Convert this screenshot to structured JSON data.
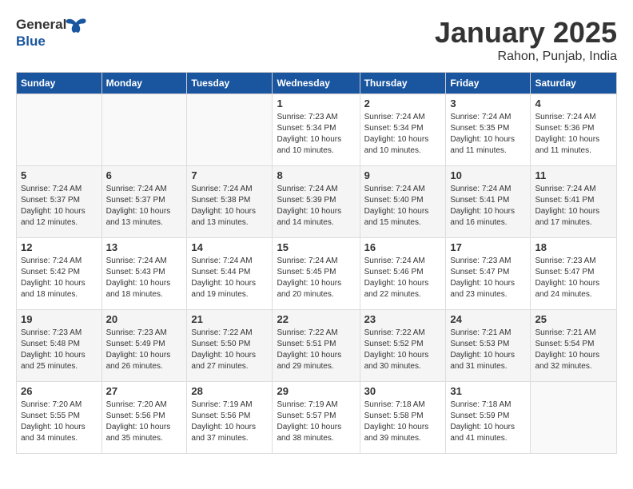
{
  "header": {
    "logo_general": "General",
    "logo_blue": "Blue",
    "month_title": "January 2025",
    "location": "Rahon, Punjab, India"
  },
  "days_of_week": [
    "Sunday",
    "Monday",
    "Tuesday",
    "Wednesday",
    "Thursday",
    "Friday",
    "Saturday"
  ],
  "weeks": [
    [
      {
        "day": "",
        "info": ""
      },
      {
        "day": "",
        "info": ""
      },
      {
        "day": "",
        "info": ""
      },
      {
        "day": "1",
        "info": "Sunrise: 7:23 AM\nSunset: 5:34 PM\nDaylight: 10 hours\nand 10 minutes."
      },
      {
        "day": "2",
        "info": "Sunrise: 7:24 AM\nSunset: 5:34 PM\nDaylight: 10 hours\nand 10 minutes."
      },
      {
        "day": "3",
        "info": "Sunrise: 7:24 AM\nSunset: 5:35 PM\nDaylight: 10 hours\nand 11 minutes."
      },
      {
        "day": "4",
        "info": "Sunrise: 7:24 AM\nSunset: 5:36 PM\nDaylight: 10 hours\nand 11 minutes."
      }
    ],
    [
      {
        "day": "5",
        "info": "Sunrise: 7:24 AM\nSunset: 5:37 PM\nDaylight: 10 hours\nand 12 minutes."
      },
      {
        "day": "6",
        "info": "Sunrise: 7:24 AM\nSunset: 5:37 PM\nDaylight: 10 hours\nand 13 minutes."
      },
      {
        "day": "7",
        "info": "Sunrise: 7:24 AM\nSunset: 5:38 PM\nDaylight: 10 hours\nand 13 minutes."
      },
      {
        "day": "8",
        "info": "Sunrise: 7:24 AM\nSunset: 5:39 PM\nDaylight: 10 hours\nand 14 minutes."
      },
      {
        "day": "9",
        "info": "Sunrise: 7:24 AM\nSunset: 5:40 PM\nDaylight: 10 hours\nand 15 minutes."
      },
      {
        "day": "10",
        "info": "Sunrise: 7:24 AM\nSunset: 5:41 PM\nDaylight: 10 hours\nand 16 minutes."
      },
      {
        "day": "11",
        "info": "Sunrise: 7:24 AM\nSunset: 5:41 PM\nDaylight: 10 hours\nand 17 minutes."
      }
    ],
    [
      {
        "day": "12",
        "info": "Sunrise: 7:24 AM\nSunset: 5:42 PM\nDaylight: 10 hours\nand 18 minutes."
      },
      {
        "day": "13",
        "info": "Sunrise: 7:24 AM\nSunset: 5:43 PM\nDaylight: 10 hours\nand 18 minutes."
      },
      {
        "day": "14",
        "info": "Sunrise: 7:24 AM\nSunset: 5:44 PM\nDaylight: 10 hours\nand 19 minutes."
      },
      {
        "day": "15",
        "info": "Sunrise: 7:24 AM\nSunset: 5:45 PM\nDaylight: 10 hours\nand 20 minutes."
      },
      {
        "day": "16",
        "info": "Sunrise: 7:24 AM\nSunset: 5:46 PM\nDaylight: 10 hours\nand 22 minutes."
      },
      {
        "day": "17",
        "info": "Sunrise: 7:23 AM\nSunset: 5:47 PM\nDaylight: 10 hours\nand 23 minutes."
      },
      {
        "day": "18",
        "info": "Sunrise: 7:23 AM\nSunset: 5:47 PM\nDaylight: 10 hours\nand 24 minutes."
      }
    ],
    [
      {
        "day": "19",
        "info": "Sunrise: 7:23 AM\nSunset: 5:48 PM\nDaylight: 10 hours\nand 25 minutes."
      },
      {
        "day": "20",
        "info": "Sunrise: 7:23 AM\nSunset: 5:49 PM\nDaylight: 10 hours\nand 26 minutes."
      },
      {
        "day": "21",
        "info": "Sunrise: 7:22 AM\nSunset: 5:50 PM\nDaylight: 10 hours\nand 27 minutes."
      },
      {
        "day": "22",
        "info": "Sunrise: 7:22 AM\nSunset: 5:51 PM\nDaylight: 10 hours\nand 29 minutes."
      },
      {
        "day": "23",
        "info": "Sunrise: 7:22 AM\nSunset: 5:52 PM\nDaylight: 10 hours\nand 30 minutes."
      },
      {
        "day": "24",
        "info": "Sunrise: 7:21 AM\nSunset: 5:53 PM\nDaylight: 10 hours\nand 31 minutes."
      },
      {
        "day": "25",
        "info": "Sunrise: 7:21 AM\nSunset: 5:54 PM\nDaylight: 10 hours\nand 32 minutes."
      }
    ],
    [
      {
        "day": "26",
        "info": "Sunrise: 7:20 AM\nSunset: 5:55 PM\nDaylight: 10 hours\nand 34 minutes."
      },
      {
        "day": "27",
        "info": "Sunrise: 7:20 AM\nSunset: 5:56 PM\nDaylight: 10 hours\nand 35 minutes."
      },
      {
        "day": "28",
        "info": "Sunrise: 7:19 AM\nSunset: 5:56 PM\nDaylight: 10 hours\nand 37 minutes."
      },
      {
        "day": "29",
        "info": "Sunrise: 7:19 AM\nSunset: 5:57 PM\nDaylight: 10 hours\nand 38 minutes."
      },
      {
        "day": "30",
        "info": "Sunrise: 7:18 AM\nSunset: 5:58 PM\nDaylight: 10 hours\nand 39 minutes."
      },
      {
        "day": "31",
        "info": "Sunrise: 7:18 AM\nSunset: 5:59 PM\nDaylight: 10 hours\nand 41 minutes."
      },
      {
        "day": "",
        "info": ""
      }
    ]
  ]
}
